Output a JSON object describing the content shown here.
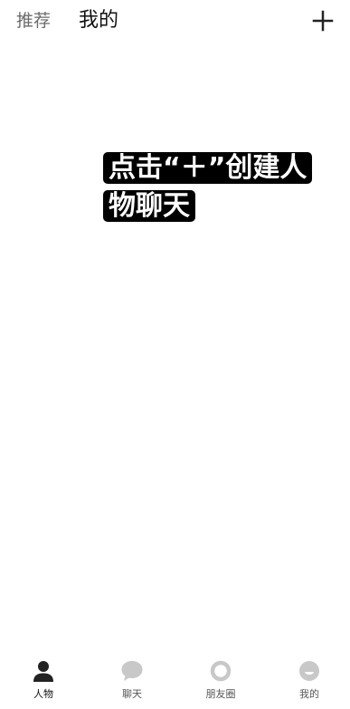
{
  "header": {
    "tabs": [
      {
        "label": "推荐",
        "active": false
      },
      {
        "label": "我的",
        "active": true
      }
    ],
    "add_icon": "plus-icon"
  },
  "hint": {
    "text": "点击“＋”创建人物聊天"
  },
  "bottom_nav": {
    "items": [
      {
        "label": "人物",
        "icon": "person-icon",
        "active": true
      },
      {
        "label": "聊天",
        "icon": "chat-bubble-icon",
        "active": false
      },
      {
        "label": "朋友圈",
        "icon": "ring-icon",
        "active": false
      },
      {
        "label": "我的",
        "icon": "smiley-icon",
        "active": false
      }
    ]
  },
  "colors": {
    "background": "#ffffff",
    "text_primary": "#111111",
    "text_secondary": "#6b6b6b",
    "hint_background": "#000000",
    "hint_text": "#ffffff",
    "active_icon": "#222222",
    "inactive_icon": "#c8c8c8"
  }
}
